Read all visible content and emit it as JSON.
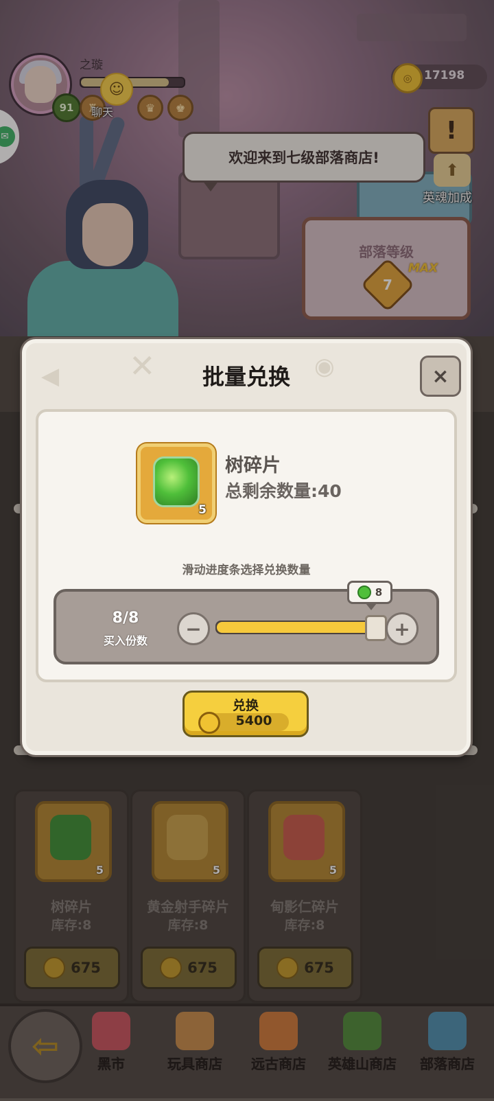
{
  "player": {
    "name": "之璇",
    "level": "91",
    "exp_fraction": 0.85
  },
  "chat": {
    "label": "聊天"
  },
  "currency": {
    "coins": "17198"
  },
  "side": {
    "hero_bonus_label": "英魂加成"
  },
  "npc": {
    "greeting": "欢迎来到七级部落商店!"
  },
  "tribe": {
    "title": "部落等级",
    "level": "7",
    "max_label": "MAX"
  },
  "modal": {
    "title": "批量兑换",
    "close_symbol": "×",
    "item_name": "树碎片",
    "item_count": "5",
    "remaining": "总剩余数量:40",
    "hint": "滑动进度条选择兑换数量",
    "selected": "8/8",
    "selected_caption": "买入份数",
    "slider_fraction": 1.0,
    "tooltip_value": "8",
    "minus_symbol": "−",
    "plus_symbol": "+",
    "exchange_label": "兑换",
    "exchange_price": "5400"
  },
  "shop_items": [
    {
      "name": "树碎片",
      "count": "5",
      "stock": "库存:8",
      "price": "675",
      "gem_color": "#3c8f35"
    },
    {
      "name": "黄金射手碎片",
      "count": "5",
      "stock": "库存:8",
      "price": "675",
      "gem_color": "#c9a24a"
    },
    {
      "name": "甸影仁碎片",
      "count": "5",
      "stock": "库存:8",
      "price": "675",
      "gem_color": "#c85a4a"
    }
  ],
  "bottom_nav": {
    "items": [
      {
        "label": "黑市",
        "icon_color": "#c9545f"
      },
      {
        "label": "玩具商店",
        "icon_color": "#c88d4a"
      },
      {
        "label": "远古商店",
        "icon_color": "#d07a3a"
      },
      {
        "label": "英雄山商店",
        "icon_color": "#4f8a3a"
      },
      {
        "label": "部落商店",
        "icon_color": "#4d8fb0"
      }
    ]
  },
  "colors": {
    "accent_gold": "#f5cf3e",
    "slider_fill": "#f6c93c"
  }
}
